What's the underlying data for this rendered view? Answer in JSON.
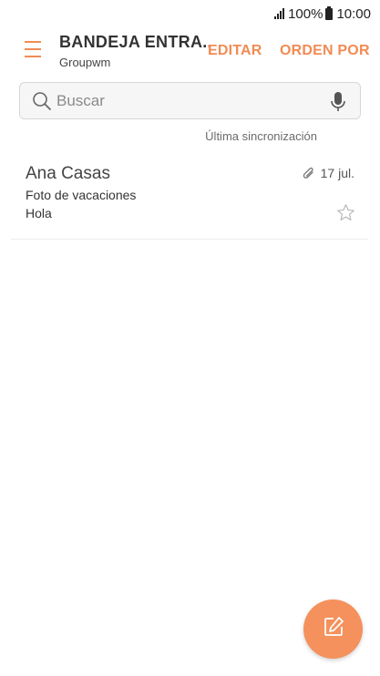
{
  "status_bar": {
    "battery": "100%",
    "time": "10:00"
  },
  "header": {
    "menu_icon": "hamburger-menu-icon",
    "title": "BANDEJA ENTRA..",
    "account": "Groupwm",
    "edit_label": "EDITAR",
    "sort_label": "ORDEN POR"
  },
  "search": {
    "placeholder": "Buscar",
    "value": "",
    "search_icon": "search-icon",
    "mic_icon": "microphone-icon"
  },
  "sync_label": "Última sincronización",
  "messages": [
    {
      "sender": "Ana Casas",
      "subject": "Foto de vacaciones",
      "preview": "Hola",
      "date": "17 jul.",
      "has_attachment": true,
      "starred": false
    }
  ],
  "fab": {
    "icon": "compose-icon"
  },
  "colors": {
    "accent": "#f28b54",
    "fab": "#f4915c",
    "text": "#333333"
  }
}
